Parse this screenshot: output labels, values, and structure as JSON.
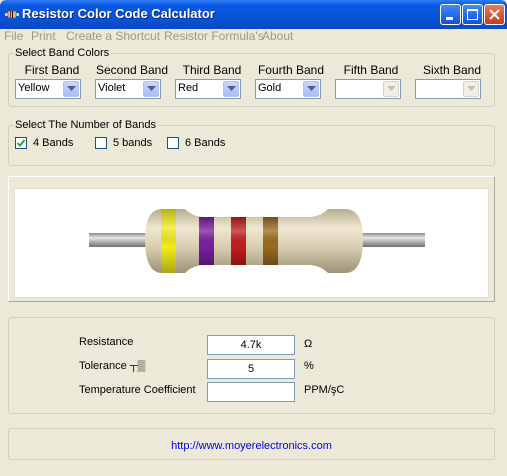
{
  "window": {
    "title": "Resistor Color Code Calculator"
  },
  "menu": [
    "File",
    "Print",
    "Create a Shortcut",
    "Resistor Formula's",
    "About"
  ],
  "band_colors": {
    "legend": "Select Band Colors",
    "bands": [
      {
        "label": "First Band",
        "value": "Yellow"
      },
      {
        "label": "Second Band",
        "value": "Violet"
      },
      {
        "label": "Third Band",
        "value": "Red"
      },
      {
        "label": "Fourth Band",
        "value": "Gold"
      },
      {
        "label": "Fifth Band",
        "value": ""
      },
      {
        "label": "Sixth Band",
        "value": ""
      }
    ]
  },
  "band_count": {
    "legend": "Select The Number of Bands",
    "options": [
      {
        "label": "4 Bands",
        "checked": true
      },
      {
        "label": "5 bands",
        "checked": false
      },
      {
        "label": "6 Bands",
        "checked": false
      }
    ]
  },
  "resistor": {
    "band_colors": [
      "#f2ec1a",
      "#7a1fa0",
      "#c41c1c",
      "#9d6a20"
    ],
    "body_color": "#d8cdb0"
  },
  "results": {
    "resistance": {
      "label": "Resistance",
      "value": "4.7k",
      "unit": "Ω"
    },
    "tolerance": {
      "label": "Tolerance ┬▒",
      "value": "5",
      "unit": "%"
    },
    "tempco": {
      "label": "Temperature Coefficient",
      "value": "",
      "unit": "PPM/şC"
    }
  },
  "footer": {
    "url": "http://www.moyerelectronics.com"
  }
}
